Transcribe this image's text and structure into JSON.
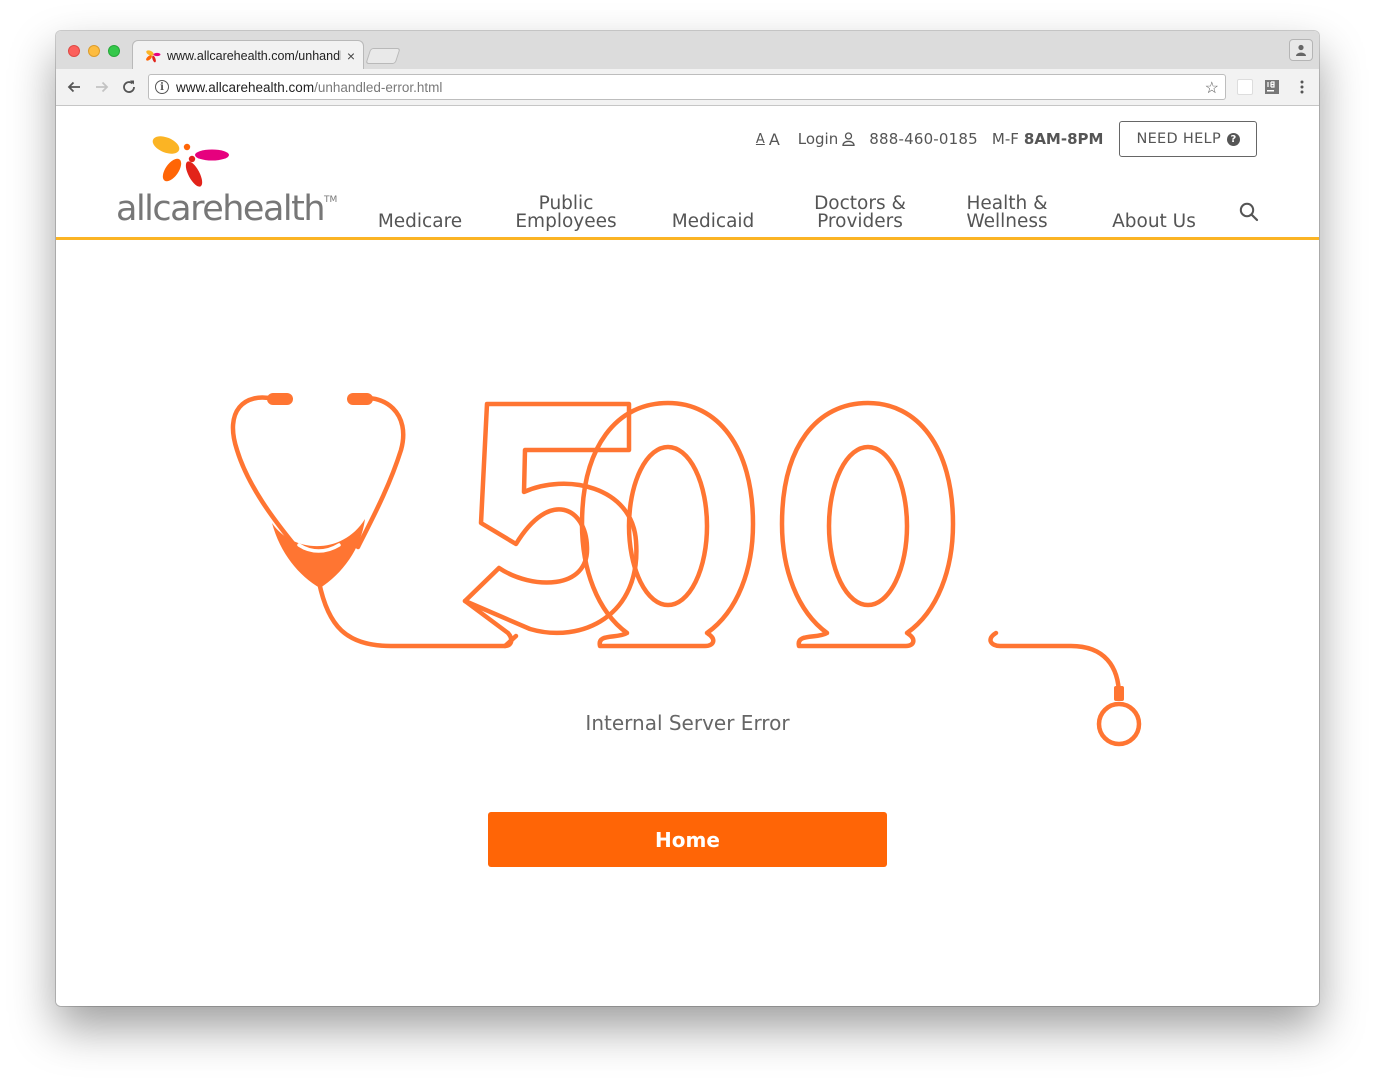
{
  "browser": {
    "tab_title": "www.allcarehealth.com/unhandled-error.html",
    "tab_close": "×",
    "url_host": "www.allcarehealth.com",
    "url_path": "/unhandled-error.html",
    "star": "☆"
  },
  "header": {
    "logo_text": "allcarehealth",
    "logo_tm": "TM",
    "font_small": "A",
    "font_large": "A",
    "login": "Login",
    "phone": "888-460-0185",
    "hours_label": "M-F",
    "hours_value": "8AM-8PM",
    "need_help": "NEED HELP",
    "need_help_icon": "?"
  },
  "nav": {
    "items": [
      {
        "label": "Medicare"
      },
      {
        "label": "Public\nEmployees"
      },
      {
        "label": "Medicaid"
      },
      {
        "label": "Doctors &\nProviders"
      },
      {
        "label": "Health &\nWellness"
      },
      {
        "label": "About Us"
      }
    ]
  },
  "main": {
    "error_code": "500",
    "error_message": "Internal Server Error",
    "home_button": "Home"
  },
  "colors": {
    "accent": "#ff6506",
    "outline": "#ff7532",
    "header_rule": "#fbb424",
    "text": "#555555"
  }
}
